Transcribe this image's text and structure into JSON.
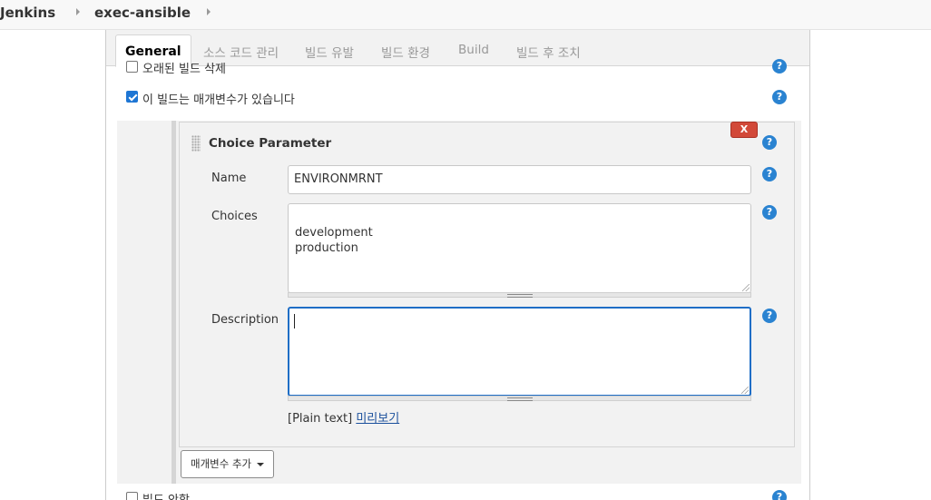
{
  "breadcrumb": {
    "items": [
      "Jenkins",
      "exec-ansible"
    ]
  },
  "tabs": [
    "General",
    "소스 코드 관리",
    "빌드 유발",
    "빌드 환경",
    "Build",
    "빌드 후 조치"
  ],
  "options": {
    "cutoff_label": "오래된 빌드 삭제",
    "parameterized_label": "이 빌드는 매개변수가 있습니다",
    "parameterized_checked": true,
    "disable_build_label": "빌드 안함",
    "disable_build_checked": false
  },
  "parameter": {
    "type_title": "Choice Parameter",
    "delete_label": "X",
    "name_label": "Name",
    "name_value": "ENVIRONMRNT",
    "choices_label": "Choices",
    "choices_value": "development\nproduction",
    "description_label": "Description",
    "description_value": "",
    "plain_text_label": "[Plain text]",
    "preview_link": "미리보기"
  },
  "add_parameter_label": "매개변수 추가",
  "help_glyph": "?",
  "colors": {
    "accent": "#2a83d1",
    "delete_red": "#d24939",
    "focus_border": "#1f6ec6",
    "checkbox_blue": "#1e76d4"
  }
}
